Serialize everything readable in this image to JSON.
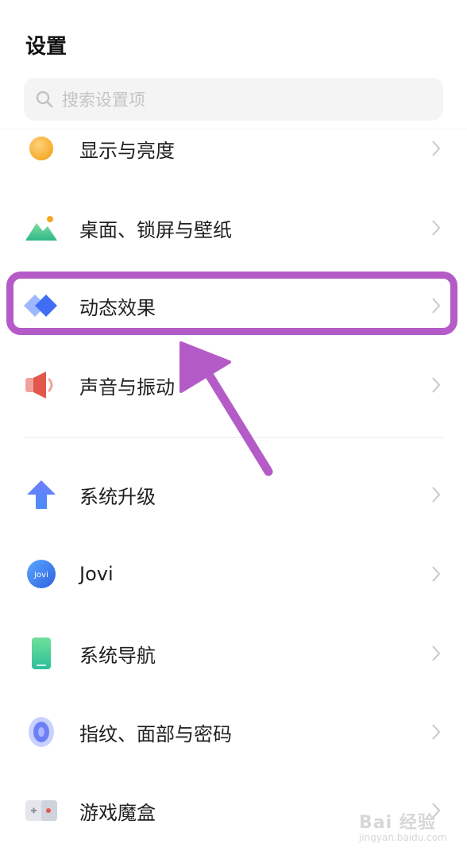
{
  "header": {
    "title": "设置"
  },
  "search": {
    "placeholder": "搜索设置项"
  },
  "items": [
    {
      "label": "显示与亮度",
      "icon": "display-brightness-icon"
    },
    {
      "label": "桌面、锁屏与壁纸",
      "icon": "wallpaper-icon"
    },
    {
      "label": "动态效果",
      "icon": "motion-effects-icon"
    },
    {
      "label": "声音与振动",
      "icon": "sound-vibration-icon"
    },
    {
      "label": "系统升级",
      "icon": "system-update-icon"
    },
    {
      "label": "Jovi",
      "icon": "jovi-icon",
      "icon_text": "Jovi"
    },
    {
      "label": "系统导航",
      "icon": "system-navigation-icon"
    },
    {
      "label": "指纹、面部与密码",
      "icon": "fingerprint-face-password-icon"
    },
    {
      "label": "游戏魔盒",
      "icon": "game-box-icon"
    }
  ],
  "annotation": {
    "color": "#b45bc7"
  },
  "watermark": {
    "line1": "Bai 经验",
    "line2": "jingyan.baidu.com"
  }
}
